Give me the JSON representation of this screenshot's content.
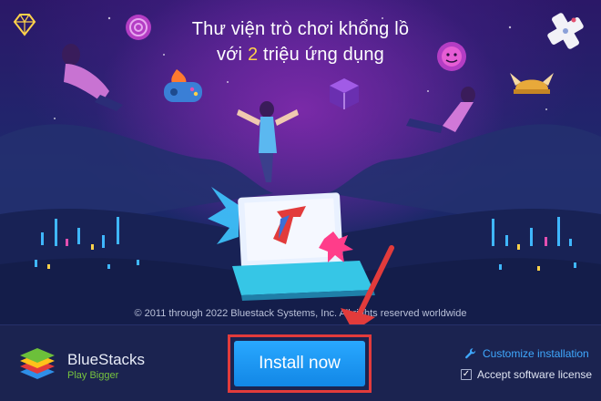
{
  "hero": {
    "headline_line1": "Thư viện trò chơi khổng lồ",
    "headline_pre": "với",
    "headline_number": "2",
    "headline_post": "triệu ứng dụng",
    "copyright": "© 2011 through 2022 Bluestack Systems, Inc. All rights reserved worldwide"
  },
  "brand": {
    "name": "BlueStacks",
    "tagline": "Play Bigger"
  },
  "actions": {
    "install_label": "Install now",
    "customize_label": "Customize installation",
    "license_label": "Accept software license",
    "license_checked": true
  },
  "colors": {
    "accent_blue": "#1287e6",
    "highlight_red": "#e23b3b",
    "tagline_green": "#77c43e",
    "link_blue": "#3fa9ff"
  }
}
